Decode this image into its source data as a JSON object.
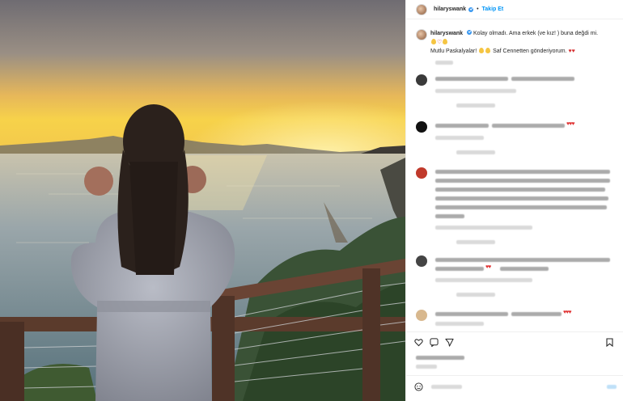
{
  "header": {
    "username": "hilaryswank",
    "follow_label": "Takip Et",
    "separator": "•"
  },
  "caption": {
    "username": "hilaryswank",
    "text_line1": "Kolay olmadı. Ama erkek (ve kız! ) buna değdi mi.",
    "text_line2a": "Mutlu Paskalyalar!",
    "text_line2b": "Saf Cennetten gönderiyorum."
  },
  "colors": {
    "accent": "#0095f6",
    "verified": "#3897f0",
    "heart": "#e03131",
    "sky_top": "#7d7a80",
    "sun": "#f7d24a"
  },
  "icons": [
    "verified-badge-icon",
    "heart-icon",
    "comment-icon",
    "share-icon",
    "bookmark-icon",
    "emoji-icon",
    "egg-icon"
  ]
}
